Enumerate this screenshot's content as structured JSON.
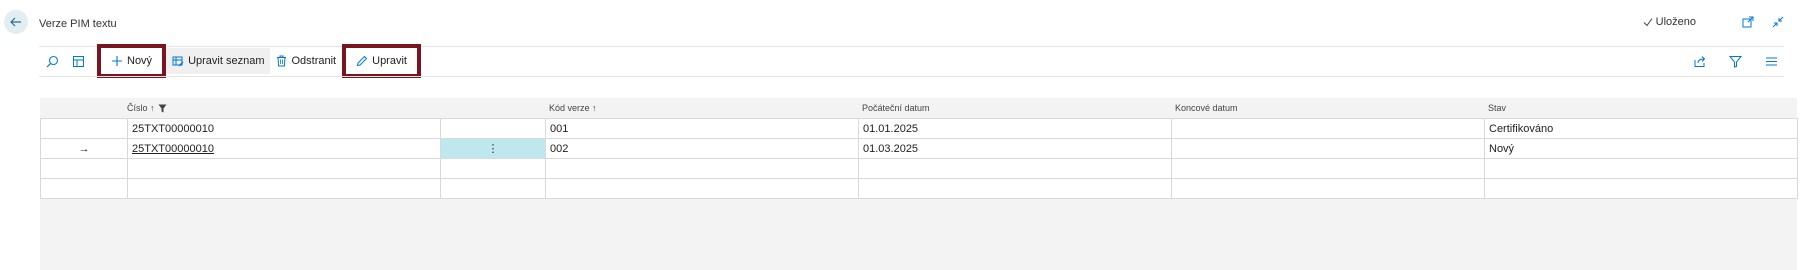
{
  "page": {
    "title": "Verze PIM textu",
    "status": "Uloženo"
  },
  "toolbar": {
    "new_label": "Nový",
    "edit_list_label": "Upravit seznam",
    "delete_label": "Odstranit",
    "edit_label": "Upravit"
  },
  "columns": {
    "cislo": "Číslo ↑",
    "kod_verze": "Kód verze ↑",
    "pocatecni_datum": "Počáteční datum",
    "koncove_datum": "Koncové datum",
    "stav": "Stav"
  },
  "rows": [
    {
      "cislo": "25TXT00000010",
      "kod_verze": "001",
      "pocatecni_datum": "01.01.2025",
      "koncove_datum": "",
      "stav": "Certifikováno"
    },
    {
      "cislo": "25TXT00000010",
      "kod_verze": "002",
      "pocatecni_datum": "01.03.2025",
      "koncove_datum": "",
      "stav": "Nový"
    }
  ],
  "selected_row_marker": "→",
  "row_menu_glyph": "⋮",
  "colors": {
    "accent": "#0078d4",
    "highlight_outline": "#7a1520",
    "selected_cell": "#bfe8ee"
  }
}
